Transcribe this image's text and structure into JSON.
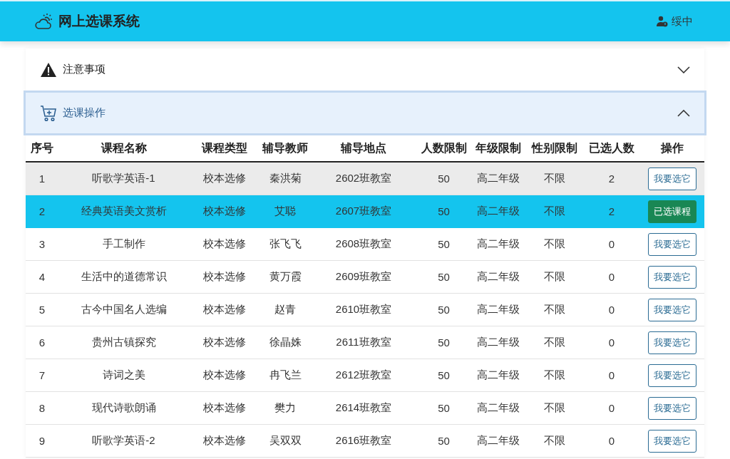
{
  "header": {
    "title": "网上选课系统",
    "user": "绥中"
  },
  "panels": [
    {
      "title": "注意事项",
      "kind": "notice",
      "expanded": false
    },
    {
      "title": "选课操作",
      "kind": "cart",
      "expanded": true
    }
  ],
  "table": {
    "columns": [
      "序号",
      "课程名称",
      "课程类型",
      "辅导教师",
      "辅导地点",
      "人数限制",
      "年级限制",
      "性别限制",
      "已选人数",
      "操作"
    ],
    "rows": [
      {
        "cells": [
          "1",
          "听歌学英语-1",
          "校本选修",
          "秦洪菊",
          "2602班教室",
          "50",
          "高二年级",
          "不限",
          "2"
        ],
        "hovered": true,
        "selected": false,
        "button": {
          "label": "我要选它",
          "kind": "choose"
        }
      },
      {
        "cells": [
          "2",
          "经典英语美文赏析",
          "校本选修",
          "艾聪",
          "2607班教室",
          "50",
          "高二年级",
          "不限",
          "2"
        ],
        "hovered": false,
        "selected": true,
        "button": {
          "label": "已选课程",
          "kind": "chosen"
        }
      },
      {
        "cells": [
          "3",
          "手工制作",
          "校本选修",
          "张飞飞",
          "2608班教室",
          "50",
          "高二年级",
          "不限",
          "0"
        ],
        "hovered": false,
        "selected": false,
        "button": {
          "label": "我要选它",
          "kind": "choose"
        }
      },
      {
        "cells": [
          "4",
          "生活中的道德常识",
          "校本选修",
          "黄万霞",
          "2609班教室",
          "50",
          "高二年级",
          "不限",
          "0"
        ],
        "hovered": false,
        "selected": false,
        "button": {
          "label": "我要选它",
          "kind": "choose"
        }
      },
      {
        "cells": [
          "5",
          "古今中国名人选编",
          "校本选修",
          "赵青",
          "2610班教室",
          "50",
          "高二年级",
          "不限",
          "0"
        ],
        "hovered": false,
        "selected": false,
        "button": {
          "label": "我要选它",
          "kind": "choose"
        }
      },
      {
        "cells": [
          "6",
          "贵州古镇探究",
          "校本选修",
          "徐晶姝",
          "2611班教室",
          "50",
          "高二年级",
          "不限",
          "0"
        ],
        "hovered": false,
        "selected": false,
        "button": {
          "label": "我要选它",
          "kind": "choose"
        }
      },
      {
        "cells": [
          "7",
          "诗词之美",
          "校本选修",
          "冉飞兰",
          "2612班教室",
          "50",
          "高二年级",
          "不限",
          "0"
        ],
        "hovered": false,
        "selected": false,
        "button": {
          "label": "我要选它",
          "kind": "choose"
        }
      },
      {
        "cells": [
          "8",
          "现代诗歌朗诵",
          "校本选修",
          "樊力",
          "2614班教室",
          "50",
          "高二年级",
          "不限",
          "0"
        ],
        "hovered": false,
        "selected": false,
        "button": {
          "label": "我要选它",
          "kind": "choose"
        }
      },
      {
        "cells": [
          "9",
          "听歌学英语-2",
          "校本选修",
          "吴双双",
          "2616班教室",
          "50",
          "高二年级",
          "不限",
          "0"
        ],
        "hovered": false,
        "selected": false,
        "button": {
          "label": "我要选它",
          "kind": "choose"
        }
      }
    ]
  }
}
